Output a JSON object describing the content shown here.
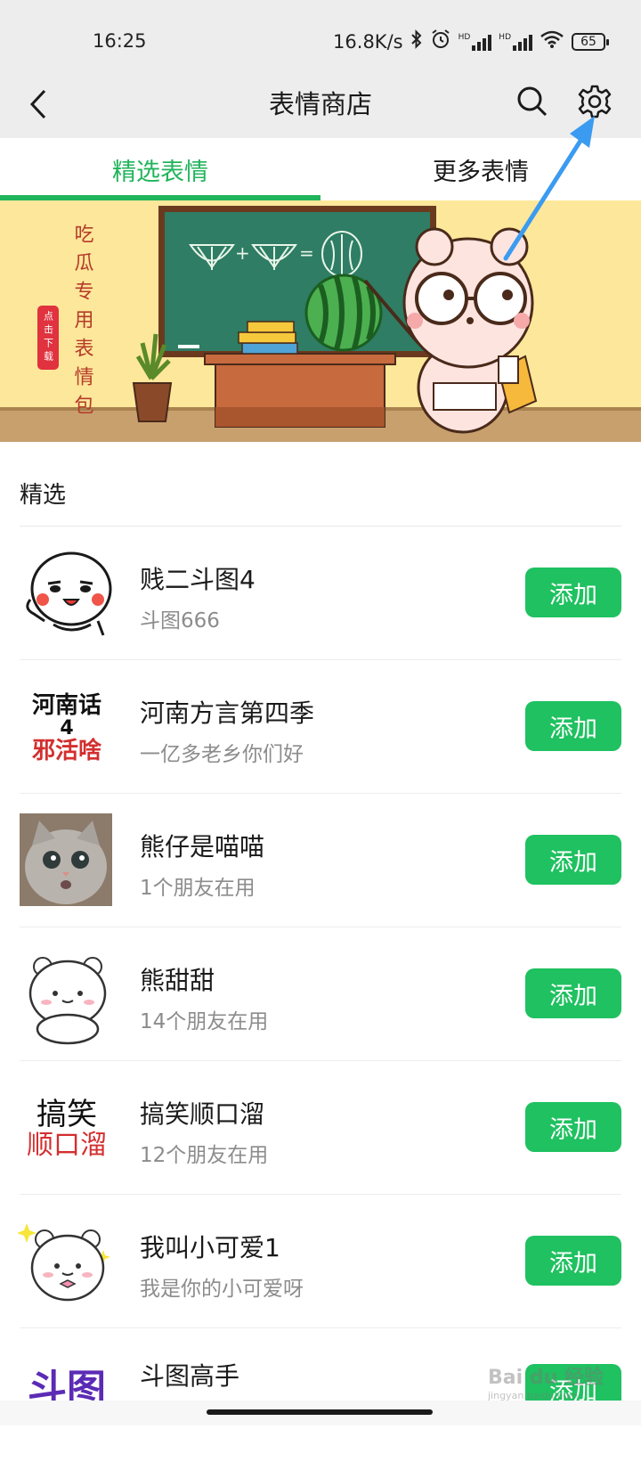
{
  "status_bar": {
    "time": "16:25",
    "network_speed": "16.8K/s",
    "battery": "65",
    "signal_label_1": "HD",
    "signal_label_2": "HD",
    "icons": [
      "bluetooth-icon",
      "alarm-icon",
      "signal-icon",
      "signal-icon",
      "wifi-icon",
      "battery-icon"
    ]
  },
  "header": {
    "title": "表情商店",
    "back_icon": "back-arrow-icon",
    "search_icon": "search-icon",
    "settings_icon": "gear-icon"
  },
  "tabs": [
    {
      "label": "精选表情",
      "active": true
    },
    {
      "label": "更多表情",
      "active": false
    }
  ],
  "banner": {
    "vertical_text": "吃瓜专用表情包",
    "tag": "点击下载",
    "colors": {
      "background": "#fde79a",
      "board": "#2e7d64",
      "floor": "#c7a06d"
    }
  },
  "section": {
    "title": "精选"
  },
  "items": [
    {
      "name": "贱二斗图4",
      "sub": "斗图666",
      "button": "添加",
      "thumb": "cartoon-face"
    },
    {
      "name": "河南方言第四季",
      "sub": "一亿多老乡你们好",
      "button": "添加",
      "thumb": "text-logo",
      "thumb_text": [
        "河南话",
        "4",
        "邪活啥"
      ]
    },
    {
      "name": "熊仔是喵喵",
      "sub": "1个朋友在用",
      "button": "添加",
      "thumb": "cat-photo"
    },
    {
      "name": "熊甜甜",
      "sub": "14个朋友在用",
      "button": "添加",
      "thumb": "bear"
    },
    {
      "name": "搞笑顺口溜",
      "sub": "12个朋友在用",
      "button": "添加",
      "thumb": "text-logo",
      "thumb_text": [
        "搞笑",
        "顺口溜"
      ]
    },
    {
      "name": "我叫小可爱1",
      "sub": "我是你的小可爱呀",
      "button": "添加",
      "thumb": "bear-sparkle"
    },
    {
      "name": "斗图高手",
      "sub": "",
      "button": "添加",
      "thumb": "text-logo",
      "thumb_text": [
        "斗图"
      ]
    }
  ],
  "watermark": {
    "text": "Bai du 经验",
    "sub": "jingyan.baidu.com"
  },
  "colors": {
    "accent": "#21b45b",
    "button": "#1fc160",
    "header_bg": "#ededed",
    "annotation_arrow": "#3b9bf0"
  }
}
